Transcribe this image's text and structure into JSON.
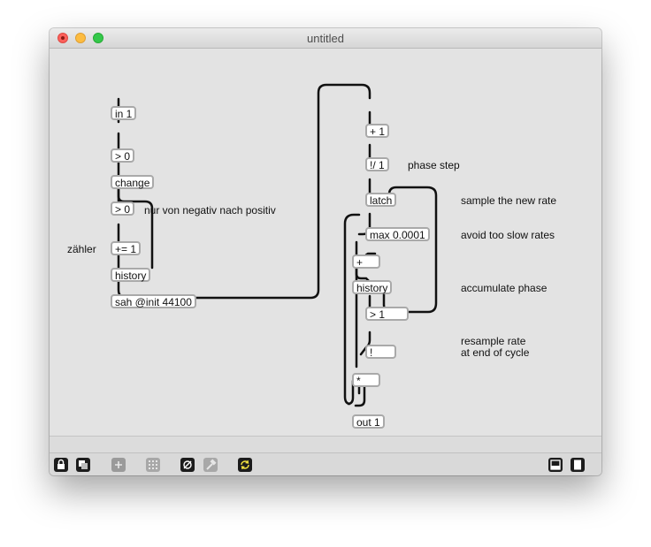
{
  "window": {
    "title": "untitled"
  },
  "objects": {
    "in1": "in 1",
    "gt0_a": "> 0",
    "change": "change",
    "gt0_b": "> 0",
    "pluseq1": "+= 1",
    "history_a": "history",
    "sah": "sah @init 44100",
    "plus1": "+ 1",
    "rdiv1": "!/ 1",
    "latch": "latch",
    "max": "max 0.0001",
    "plus": "+",
    "history_b": "history",
    "gt1": "> 1",
    "not": "!",
    "mul": "*",
    "out1": "out 1"
  },
  "comments": {
    "nur_von": "nur von negativ nach positiv",
    "zaehler": "zähler",
    "phase_step": "phase step",
    "sample_rate": "sample the new rate",
    "avoid": "avoid too slow rates",
    "accumulate": "accumulate phase",
    "resample_1": "resample rate",
    "resample_2": "at end of cycle"
  },
  "toolbar": {
    "icons": [
      "lock-icon",
      "presentation-icon",
      "add-object-icon",
      "grid-icon",
      "mute-icon",
      "debug-hammer-icon",
      "autorefresh-icon",
      "sidebar-left-icon",
      "sidebar-right-icon"
    ],
    "autorefresh_color": "#f0e040"
  }
}
